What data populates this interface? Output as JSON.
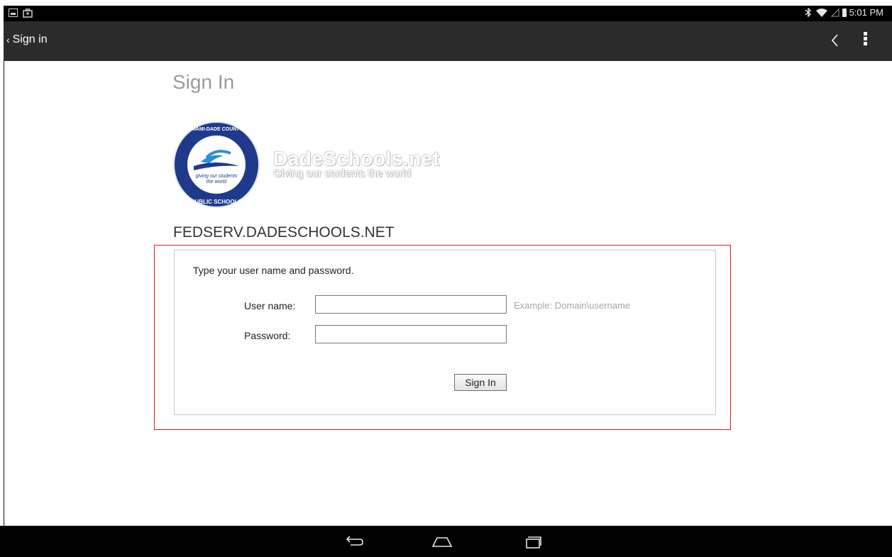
{
  "status_bar": {
    "time": "5:01 PM",
    "left_icons": [
      "picture-icon",
      "briefcase-icon"
    ],
    "right_icons": [
      "bluetooth-icon",
      "wifi-icon",
      "signal-icon",
      "battery-icon"
    ]
  },
  "action_bar": {
    "back_label": "Sign in",
    "prev_icon": "chevron-left-icon",
    "menu_icon": "overflow-menu-icon"
  },
  "page": {
    "title": "Sign In",
    "logo": {
      "seal_text_top": "MIAMI-DADE COUNTY",
      "seal_text_bottom": "PUBLIC SCHOOLS",
      "seal_motto": "giving our students the world",
      "brand_name": "DadeSchools.net",
      "brand_tagline": "Giving our students the world"
    },
    "server_name": "FEDSERV.DADESCHOOLS.NET"
  },
  "form": {
    "instructions": "Type your user name and password.",
    "username_label": "User name:",
    "username_value": "",
    "username_hint": "Example: Domain\\username",
    "password_label": "Password:",
    "password_value": "",
    "submit_label": "Sign In"
  },
  "nav_bar": {
    "buttons": [
      "back-icon",
      "home-icon",
      "recent-apps-icon"
    ]
  },
  "colors": {
    "status_bar": "#000000",
    "action_bar": "#2b2b2b",
    "highlight_border": "#dc1e26",
    "title_gray": "#9a9a9a",
    "hint_gray": "#a7a7a7"
  }
}
